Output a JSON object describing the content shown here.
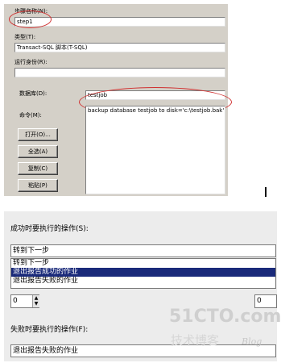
{
  "top": {
    "step_name_label": "步骤名称(N):",
    "step_name_value": "step1",
    "type_label": "类型(T):",
    "type_value": "Transact-SQL 脚本(T-SQL)",
    "run_as_label": "运行身份(R):",
    "run_as_value": "",
    "database_label": "数据库(D):",
    "database_value": "testjob",
    "command_label": "命令(M):",
    "command_value": "backup database testjob to disk='c:\\testjob.bak'",
    "buttons": {
      "open": "打开(O)...",
      "select_all": "全选(A)",
      "copy": "复制(C)",
      "paste": "粘贴(P)"
    },
    "highlight_color": "#d03030"
  },
  "bottom": {
    "on_success_label": "成功时要执行的操作(S):",
    "on_success_value": "转到下一步",
    "options": [
      "转到下一步",
      "退出报告成功的作业",
      "退出报告失败的作业"
    ],
    "selected_option_index": 1,
    "retry_value_left": "0",
    "retry_value_right": "0",
    "on_failure_label": "失败时要执行的操作(F):",
    "on_failure_value": "退出报告失败的作业",
    "selection_color": "#1a2a7a"
  },
  "watermark": {
    "logo": "51CTO.com",
    "subtitle": "技术博客",
    "blog": "Blog"
  }
}
